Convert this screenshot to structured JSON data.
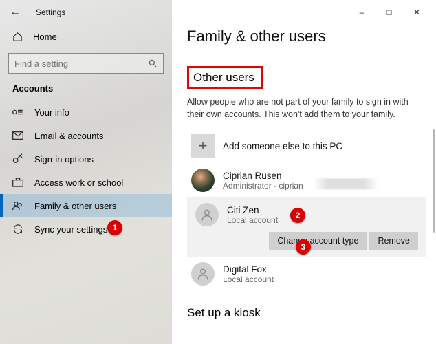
{
  "window": {
    "app_title": "Settings"
  },
  "sidebar": {
    "home_label": "Home",
    "search_placeholder": "Find a setting",
    "group_label": "Accounts",
    "items": [
      {
        "label": "Your info"
      },
      {
        "label": "Email & accounts"
      },
      {
        "label": "Sign-in options"
      },
      {
        "label": "Access work or school"
      },
      {
        "label": "Family & other users"
      },
      {
        "label": "Sync your settings"
      }
    ]
  },
  "main": {
    "page_title": "Family & other users",
    "section_title": "Other users",
    "section_desc": "Allow people who are not part of your family to sign in with their own accounts. This won't add them to your family.",
    "add_label": "Add someone else to this PC",
    "users": [
      {
        "name": "Ciprian Rusen",
        "sub": "Administrator - ciprian"
      },
      {
        "name": "Citi Zen",
        "sub": "Local account"
      },
      {
        "name": "Digital Fox",
        "sub": "Local account"
      }
    ],
    "buttons": {
      "change": "Change account type",
      "remove": "Remove"
    },
    "kiosk_title": "Set up a kiosk"
  },
  "markers": {
    "m1": "1",
    "m2": "2",
    "m3": "3"
  }
}
